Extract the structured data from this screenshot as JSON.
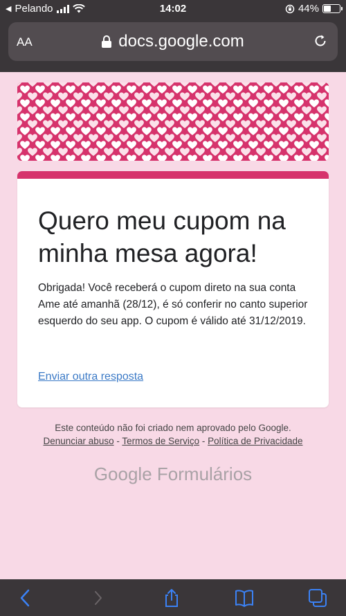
{
  "status_bar": {
    "carrier": "Pelando",
    "time": "14:02",
    "battery": "44%",
    "battery_level": 0.44
  },
  "browser": {
    "text_size_label": "AA",
    "url": "docs.google.com"
  },
  "form": {
    "title": "Quero meu cupom na minha mesa agora!",
    "confirmation": "Obrigada! Você receberá o cupom direto na sua conta Ame até amanhã (28/12), é só conferir no canto superior esquerdo do seu app. O cupom é válido até 31/12/2019.",
    "submit_another": "Enviar outra resposta"
  },
  "footer": {
    "disclaimer": "Este conteúdo não foi criado nem aprovado pelo Google.",
    "report_abuse": "Denunciar abuso",
    "separator1": " - ",
    "terms": "Termos de Serviço",
    "separator2": " - ",
    "privacy": "Política de Privacidade",
    "brand_google": "Google",
    "brand_forms": "Formulários"
  },
  "colors": {
    "accent": "#d6336c",
    "page_bg": "#f8d9e6",
    "link": "#3a79c6",
    "chrome": "#3a3639",
    "toolbar_icon": "#3b82f6"
  },
  "icons": {
    "back": "chevron-left-icon",
    "forward": "chevron-right-icon",
    "share": "share-icon",
    "bookmarks": "book-icon",
    "tabs": "tabs-icon"
  }
}
